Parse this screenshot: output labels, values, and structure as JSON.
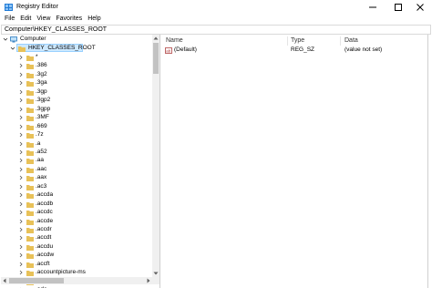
{
  "window": {
    "title": "Registry Editor"
  },
  "menu": [
    "File",
    "Edit",
    "View",
    "Favorites",
    "Help"
  ],
  "address": "Computer\\HKEY_CLASSES_ROOT",
  "tree": {
    "root": "Computer",
    "hive": "HKEY_CLASSES_ROOT",
    "keys": [
      "*",
      ".386",
      ".3g2",
      ".3ga",
      ".3gp",
      ".3gp2",
      ".3gpp",
      ".3MF",
      ".669",
      ".7z",
      ".a",
      ".a52",
      ".aa",
      ".aac",
      ".aax",
      ".ac3",
      ".accda",
      ".accdb",
      ".accdc",
      ".accde",
      ".accdr",
      ".accdt",
      ".accdu",
      ".accdw",
      ".accft",
      ".accountpicture-ms",
      ".acl",
      ".ade"
    ]
  },
  "list": {
    "columns": [
      "Name",
      "Type",
      "Data"
    ],
    "rows": [
      {
        "name": "(Default)",
        "type": "REG_SZ",
        "data": "(value not set)"
      }
    ]
  },
  "colors": {
    "selection": "#cce8ff",
    "folder": "#e8c158",
    "app_icon": "#1f7ad6"
  }
}
